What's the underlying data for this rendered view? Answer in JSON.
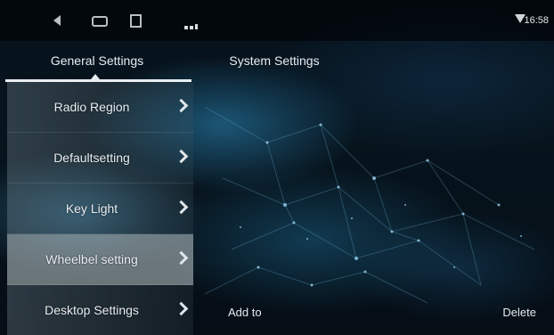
{
  "status_bar": {
    "back_icon": "back-triangle-icon",
    "home_icon": "home-rounded-rect-icon",
    "recent_icon": "recent-apps-icon",
    "time": "16:58"
  },
  "tabs": [
    {
      "label": "General Settings",
      "active": true
    },
    {
      "label": "System Settings",
      "active": false
    }
  ],
  "menu": {
    "items": [
      {
        "label": "Radio Region",
        "selected": false
      },
      {
        "label": "Defaultsetting",
        "selected": false
      },
      {
        "label": "Key Light",
        "selected": false
      },
      {
        "label": "Wheelbel setting",
        "selected": true
      },
      {
        "label": "Desktop Settings",
        "selected": false
      }
    ]
  },
  "actions": {
    "add_label": "Add to",
    "delete_label": "Delete"
  },
  "colors": {
    "background": "#06121c",
    "selected_item": "#aab4b8",
    "text": "#e8eef2"
  }
}
